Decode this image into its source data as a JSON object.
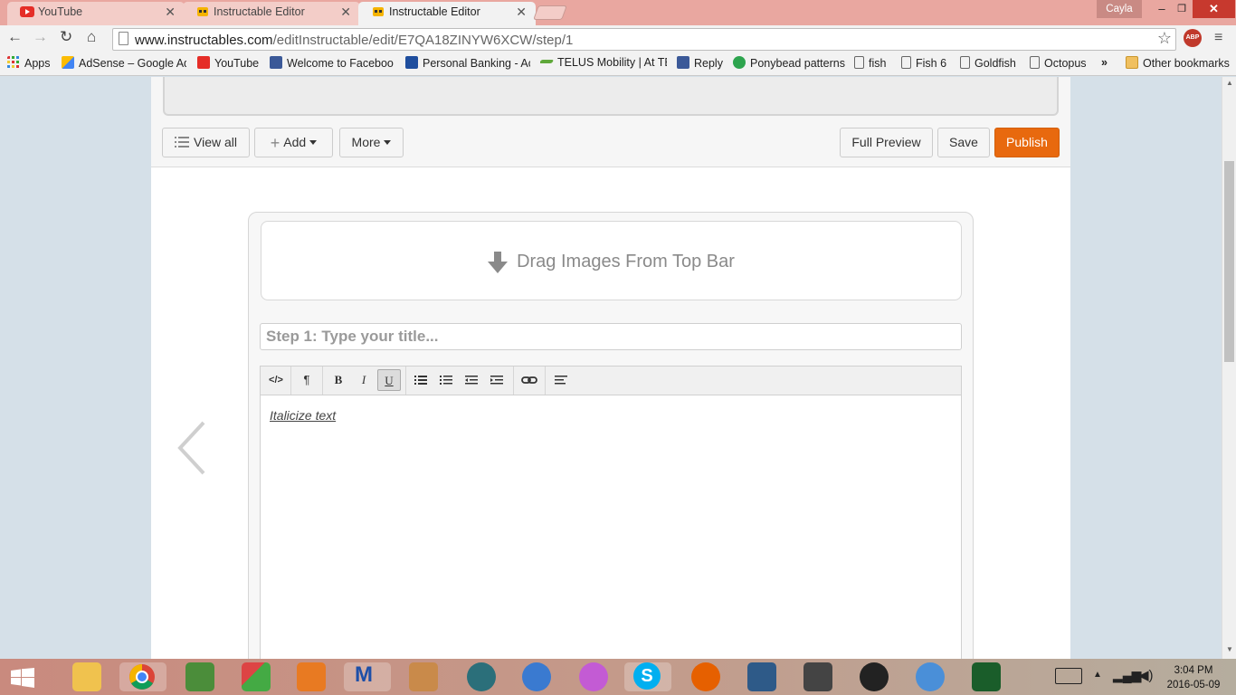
{
  "browser": {
    "tabs": [
      {
        "title": "YouTube",
        "active": false
      },
      {
        "title": "Instructable Editor",
        "active": false
      },
      {
        "title": "Instructable Editor",
        "active": true
      }
    ],
    "profile_name": "Cayla",
    "url_host": "www.instructables.com",
    "url_path": "/editInstructable/edit/E7QA18ZINYW6XCW/step/1",
    "abp_label": "ABP",
    "bookmarks": [
      {
        "label": "Apps",
        "icon": "apps-grid-icon"
      },
      {
        "label": "AdSense – Google Ad",
        "icon": "adsense-icon"
      },
      {
        "label": "YouTube",
        "icon": "youtube-icon"
      },
      {
        "label": "Welcome to Faceboo",
        "icon": "facebook-icon"
      },
      {
        "label": "Personal Banking - Ac",
        "icon": "bank-icon"
      },
      {
        "label": "TELUS Mobility | At TE",
        "icon": "telus-icon"
      },
      {
        "label": "Reply",
        "icon": "facebook-icon"
      },
      {
        "label": "Ponybead patterns",
        "icon": "green-circle-icon"
      },
      {
        "label": "fish",
        "icon": "page-icon"
      },
      {
        "label": "Fish 6",
        "icon": "page-icon"
      },
      {
        "label": "Goldfish",
        "icon": "page-icon"
      },
      {
        "label": "Octopus",
        "icon": "page-icon"
      }
    ],
    "bookmarks_overflow": "»",
    "other_bookmarks": "Other bookmarks"
  },
  "editor": {
    "view_all": "View all",
    "add": "Add",
    "more": "More",
    "full_preview": "Full Preview",
    "save": "Save",
    "publish": "Publish",
    "dropzone_text": "Drag Images From Top Bar",
    "step_placeholder": "Step 1:  Type your title...",
    "body_text": "Italicize text",
    "toolbar": {
      "source": "</>",
      "paragraph": "¶",
      "bold": "B",
      "italic": "I",
      "underline": "U"
    }
  },
  "taskbar": {
    "time": "3:04 PM",
    "date": "2016-05-09"
  },
  "colors": {
    "publish": "#e8690e",
    "tab_strip": "#e9a7a0",
    "page_bg": "#d5e0e8"
  }
}
